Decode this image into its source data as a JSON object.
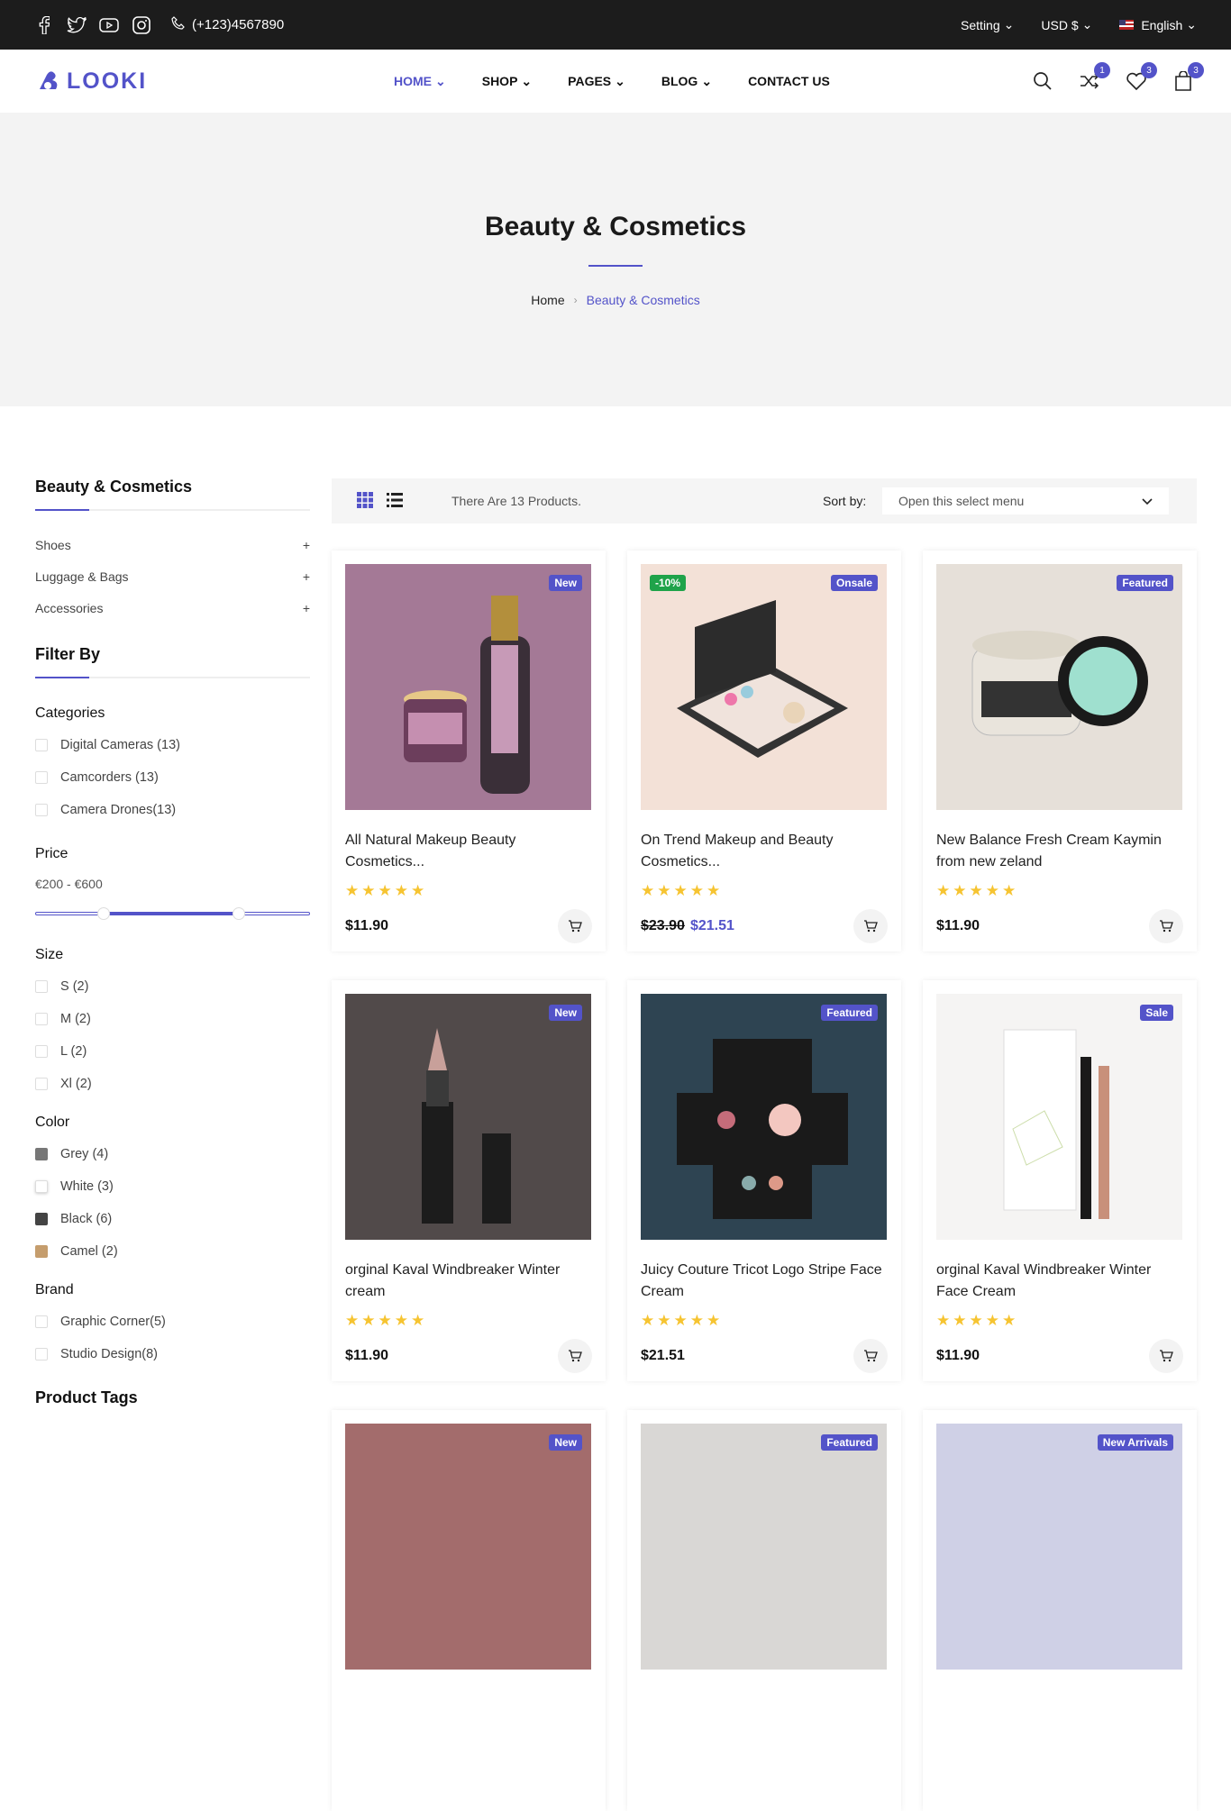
{
  "topbar": {
    "phone": "(+123)4567890",
    "social": [
      "facebook-icon",
      "twitter-icon",
      "youtube-icon",
      "instagram-icon"
    ],
    "setting": "Setting",
    "currency": "USD $",
    "language": "English"
  },
  "header": {
    "logo": "LOOKI",
    "nav": [
      {
        "label": "HOME",
        "dropdown": true,
        "active": true
      },
      {
        "label": "SHOP",
        "dropdown": true
      },
      {
        "label": "PAGES",
        "dropdown": true
      },
      {
        "label": "BLOG",
        "dropdown": true
      },
      {
        "label": "CONTACT US",
        "dropdown": false
      }
    ],
    "compare_count": "1",
    "wishlist_count": "3",
    "cart_count": "3"
  },
  "hero": {
    "title": "Beauty & Cosmetics",
    "breadcrumb_home": "Home",
    "breadcrumb_current": "Beauty & Cosmetics"
  },
  "sidebar": {
    "category_title": "Beauty & Cosmetics",
    "categories": [
      "Shoes",
      "Luggage & Bags",
      "Accessories"
    ],
    "filter_title": "Filter By",
    "categories_label": "Categories",
    "category_filters": [
      "Digital Cameras (13)",
      "Camcorders (13)",
      "Camera Drones(13)"
    ],
    "price_label": "Price",
    "price_range": "€200 - €600",
    "size_label": "Size",
    "sizes": [
      "S (2)",
      "M (2)",
      "L (2)",
      "Xl (2)"
    ],
    "color_label": "Color",
    "colors": [
      {
        "label": "Grey (4)",
        "color": "#777777"
      },
      {
        "label": "White (3)",
        "color": "#ffffff"
      },
      {
        "label": "Black (6)",
        "color": "#444444"
      },
      {
        "label": "Camel (2)",
        "color": "#c59d6d"
      }
    ],
    "brand_label": "Brand",
    "brands": [
      "Graphic Corner(5)",
      "Studio Design(8)"
    ],
    "tags_label": "Product Tags"
  },
  "toolbar": {
    "count_text": "There Are 13 Products.",
    "sort_label": "Sort by:",
    "sort_value": "Open this select menu"
  },
  "products": [
    {
      "title": "All Natural Makeup Beauty Cosmetics...",
      "price": "$11.90",
      "old_price": "",
      "tags": [
        "New"
      ],
      "bg": "#a47996"
    },
    {
      "title": "On Trend Makeup and Beauty Cosmetics...",
      "price": "$21.51",
      "old_price": "$23.90",
      "tags": [
        "-10%",
        "Onsale"
      ],
      "bg": "#f3e1d7"
    },
    {
      "title": "New Balance Fresh Cream Kaymin from new zeland",
      "price": "$11.90",
      "old_price": "",
      "tags": [
        "Featured"
      ],
      "bg": "#e6e0d9"
    },
    {
      "title": "orginal Kaval Windbreaker Winter cream",
      "price": "$11.90",
      "old_price": "",
      "tags": [
        "New"
      ],
      "bg": "#514a4a"
    },
    {
      "title": "Juicy Couture Tricot Logo Stripe Face Cream",
      "price": "$21.51",
      "old_price": "",
      "tags": [
        "Featured"
      ],
      "bg": "#2e4452"
    },
    {
      "title": "orginal Kaval Windbreaker Winter Face Cream",
      "price": "$11.90",
      "old_price": "",
      "tags": [
        "Sale"
      ],
      "bg": "#f5f4f3"
    },
    {
      "title": "",
      "price": "",
      "old_price": "",
      "tags": [
        "New"
      ],
      "bg": "#a36c6c"
    },
    {
      "title": "",
      "price": "",
      "old_price": "",
      "tags": [
        "Featured"
      ],
      "bg": "#d9d7d5"
    },
    {
      "title": "",
      "price": "",
      "old_price": "",
      "tags": [
        "New Arrivals"
      ],
      "bg": "#cfd0e6"
    }
  ],
  "rating_stars": "★★★★★",
  "colors": {
    "accent": "#5353c9",
    "tag_green": "#1fa34a",
    "star": "#f6c431"
  }
}
